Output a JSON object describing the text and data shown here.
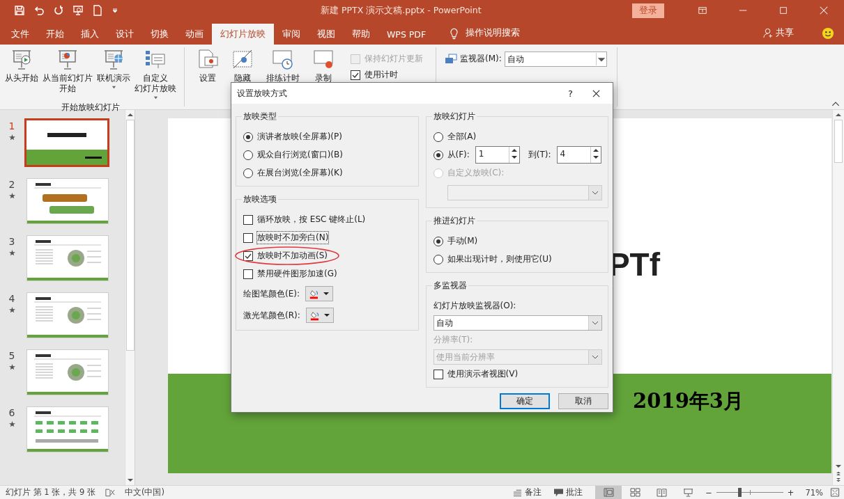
{
  "window": {
    "title": "新建 PPTX 演示文稿.pptx  -  PowerPoint",
    "login_button": "登录"
  },
  "tabs": [
    {
      "label": "文件",
      "selected": false
    },
    {
      "label": "开始",
      "selected": false
    },
    {
      "label": "插入",
      "selected": false
    },
    {
      "label": "设计",
      "selected": false
    },
    {
      "label": "切换",
      "selected": false
    },
    {
      "label": "动画",
      "selected": false
    },
    {
      "label": "幻灯片放映",
      "selected": true
    },
    {
      "label": "审阅",
      "selected": false
    },
    {
      "label": "视图",
      "selected": false
    },
    {
      "label": "帮助",
      "selected": false
    },
    {
      "label": "WPS PDF",
      "selected": false
    }
  ],
  "tell_me": "操作说明搜索",
  "share": "共享",
  "ribbon": {
    "start_group": {
      "label": "开始放映幻灯片",
      "buttons": [
        {
          "kind": "from_start",
          "lines": [
            "从头开始"
          ],
          "dropdown": false
        },
        {
          "kind": "from_current",
          "lines": [
            "从当前幻灯片",
            "开始"
          ],
          "dropdown": false
        },
        {
          "kind": "online",
          "lines": [
            "联机演示"
          ],
          "dropdown": true
        },
        {
          "kind": "custom",
          "lines": [
            "自定义",
            "幻灯片放映"
          ],
          "dropdown": true
        }
      ]
    },
    "setup_buttons": [
      {
        "kind": "setup",
        "label": "设置"
      },
      {
        "kind": "hide",
        "label": "隐藏"
      },
      {
        "kind": "rehearse",
        "label": "排练计时"
      },
      {
        "kind": "record",
        "label": "录制"
      }
    ],
    "checkboxes": [
      {
        "label": "保持幻灯片更新",
        "checked": false,
        "disabled": true
      },
      {
        "label": "使用计时",
        "checked": true,
        "disabled": false
      }
    ],
    "monitor_label": "监视器(M):",
    "monitor_value": "自动"
  },
  "thumbnails": [
    {
      "number": "1",
      "selected": true,
      "kind": "title"
    },
    {
      "number": "2",
      "selected": false,
      "kind": "toc"
    },
    {
      "number": "3",
      "selected": false,
      "kind": "content"
    },
    {
      "number": "4",
      "selected": false,
      "kind": "content"
    },
    {
      "number": "5",
      "selected": false,
      "kind": "content"
    },
    {
      "number": "6",
      "selected": false,
      "kind": "flow"
    }
  ],
  "slide": {
    "title_fragment": "PTf",
    "date": "2019年3月"
  },
  "dialog": {
    "title": "设置放映方式",
    "help": "?",
    "show_type": {
      "legend": "放映类型",
      "options": [
        {
          "label": "演讲者放映(全屏幕)(P)",
          "selected": true
        },
        {
          "label": "观众自行浏览(窗口)(B)",
          "selected": false
        },
        {
          "label": "在展台浏览(全屏幕)(K)",
          "selected": false
        }
      ]
    },
    "show_options": {
      "legend": "放映选项",
      "checkboxes": [
        {
          "label": "循环放映，按 ESC 键终止(L)",
          "checked": false,
          "focused": false,
          "highlighted": false
        },
        {
          "label": "放映时不加旁白(N)",
          "checked": false,
          "focused": true,
          "highlighted": false
        },
        {
          "label": "放映时不加动画(S)",
          "checked": true,
          "focused": false,
          "highlighted": true
        },
        {
          "label": "禁用硬件图形加速(G)",
          "checked": false,
          "focused": false,
          "highlighted": false
        }
      ],
      "pen_colors": [
        {
          "label": "绘图笔颜色(E):",
          "color": "#ff0000"
        },
        {
          "label": "激光笔颜色(R):",
          "color": "#ff0000"
        }
      ]
    },
    "slides_range": {
      "legend": "放映幻灯片",
      "options": [
        {
          "label": "全部(A)",
          "selected": false,
          "disabled": false
        },
        {
          "label": "从(F):",
          "selected": true,
          "disabled": false
        },
        {
          "label": "自定义放映(C):",
          "selected": false,
          "disabled": true
        }
      ],
      "from": "1",
      "to_label": "到(T):",
      "to": "4"
    },
    "advance": {
      "legend": "推进幻灯片",
      "options": [
        {
          "label": "手动(M)",
          "selected": true
        },
        {
          "label": "如果出现计时，则使用它(U)",
          "selected": false
        }
      ]
    },
    "monitors": {
      "legend": "多监视器",
      "monitor_label": "幻灯片放映监视器(O):",
      "monitor_value": "自动",
      "resolution_label": "分辨率(T):",
      "resolution_value": "使用当前分辨率",
      "presenter_view": {
        "label": "使用演示者视图(V)",
        "checked": false
      }
    },
    "buttons": [
      {
        "label": "确定",
        "default": true
      },
      {
        "label": "取消",
        "default": false
      }
    ]
  },
  "status_bar": {
    "slide_info": "幻灯片 第 1 张，共 9 张",
    "language": "中文(中国)",
    "notes": "备注",
    "comments": "批注",
    "views": [
      {
        "kind": "normal",
        "selected": true
      },
      {
        "kind": "sorter",
        "selected": false
      },
      {
        "kind": "reading",
        "selected": false
      },
      {
        "kind": "slideshow",
        "selected": false
      }
    ],
    "zoom": {
      "minus": "−",
      "plus": "+",
      "level": 0.36,
      "percent": "71%"
    }
  }
}
